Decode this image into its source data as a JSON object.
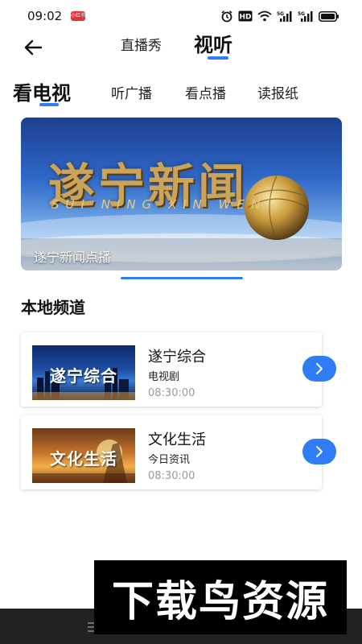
{
  "status_bar": {
    "time": "09:02",
    "app_badge": "小红书",
    "hd_label": "HD",
    "net1": "5G",
    "net2": "5G"
  },
  "top_nav": {
    "back_icon": "arrow-left-icon",
    "tabs": [
      {
        "label": "直播秀",
        "active": false
      },
      {
        "label": "视听",
        "active": true
      }
    ]
  },
  "sub_tabs": [
    {
      "label": "看电视",
      "active": true
    },
    {
      "label": "听广播",
      "active": false
    },
    {
      "label": "看点播",
      "active": false
    },
    {
      "label": "读报纸",
      "active": false
    }
  ],
  "banner": {
    "logo_text": "遂宁新闻",
    "pinyin": "SUI NING XIN WEN",
    "caption": "遂宁新闻点播"
  },
  "section": {
    "title": "本地频道"
  },
  "channels": [
    {
      "thumb_text": "遂宁综合",
      "name": "遂宁综合",
      "type": "电视剧",
      "time": "08:30:00"
    },
    {
      "thumb_text": "文化生活",
      "name": "文化生活",
      "type": "今日资讯",
      "time": "08:30:00"
    }
  ],
  "watermark": {
    "text": "下载鸟资源"
  },
  "colors": {
    "accent": "#2f7df6",
    "bottom_bar": "#222222"
  }
}
